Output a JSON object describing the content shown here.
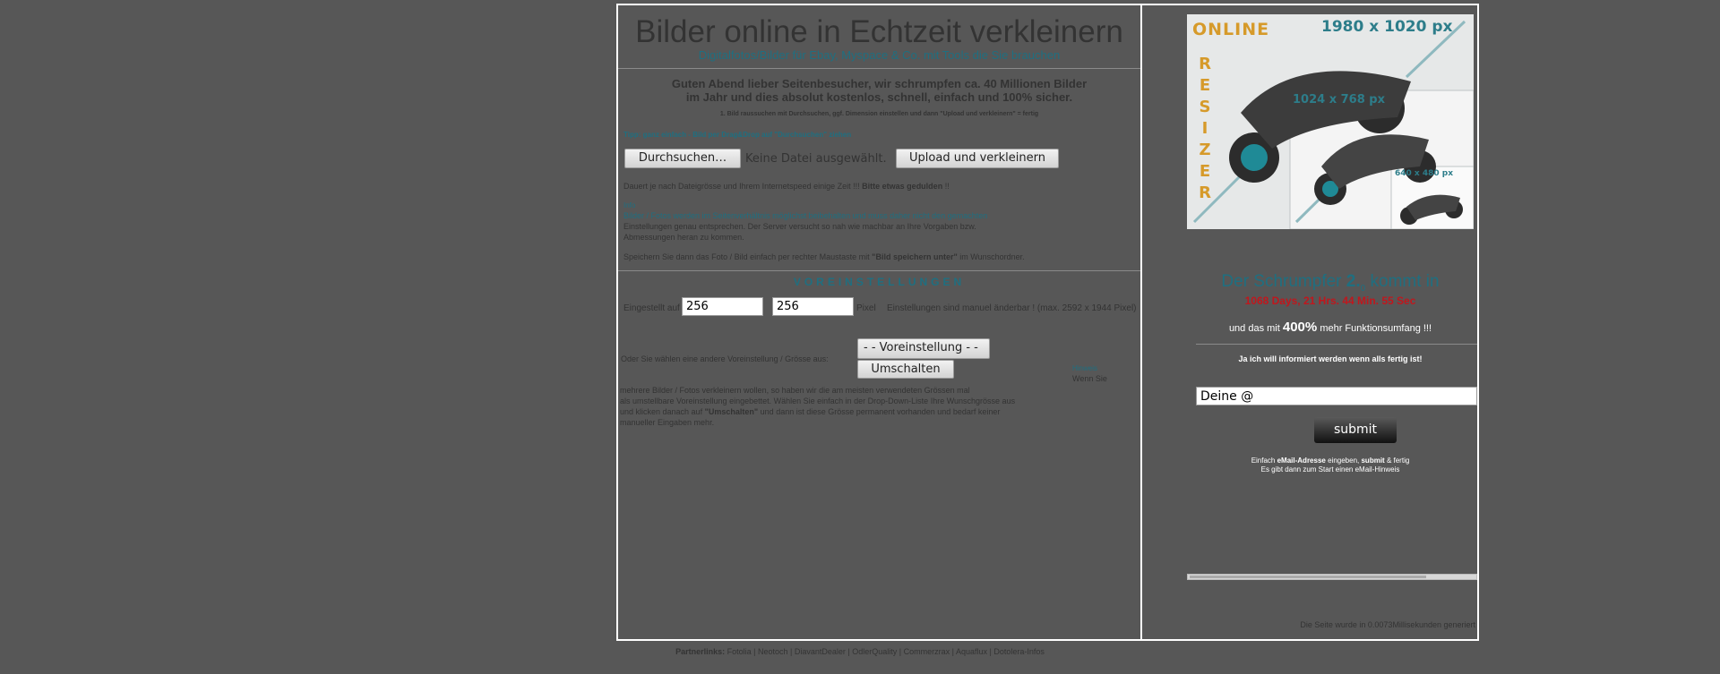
{
  "header": {
    "title": "Bilder online in Echtzeit verkleinern",
    "subtitle": "Digitalfotos/Bilder für Ebay, Myspace & Co. mit Tools die Sie brauchen"
  },
  "intro": {
    "greeting_line1": "Guten Abend lieber Seitenbesucher, wir schrumpfen ca. 40 Millionen Bilder",
    "greeting_line2": "im Jahr und dies absolut kostenlos, schnell, einfach und 100% sicher.",
    "steps": "1. Bild raussuchen mit Durchsuchen, ggf. Dimension einstellen und dann \"Upload und verkleinern\" = fertig",
    "tip": "Tipp: ganz einfach - Bild per Drag&Drop auf \"Durchsuchen\" ziehen"
  },
  "upload": {
    "browse_label": "Durchsuchen…",
    "no_file_text": "Keine Datei ausgewählt.",
    "upload_label": "Upload und verkleinern"
  },
  "info": {
    "wait_text": "Dauert je nach Dateigrösse und Ihrem Internetspeed einige Zeit !!!",
    "wait_bold": "Bitte etwas gedulden",
    "wait_end": "!!",
    "label_small": "Info",
    "ratio_text1": "Bilder / Fotos werden im Seitenverhältnis möglichst beibehalten und muss daher nicht den gemachten",
    "ratio_text2": "Einstellungen genau entsprechen. Der Server versucht so nah wie machbar an Ihre Vorgaben bzw.",
    "ratio_text3": "Abmessungen heran zu kommen.",
    "save_text": "Speichern Sie dann das Foto / Bild einfach per rechter Maustaste mit",
    "save_bold": "\"Bild speichern unter\"",
    "save_end": "im Wunschordner."
  },
  "settings": {
    "section_title": "VOREINSTELLUNGEN",
    "size_label": "Eingestellt auf",
    "width_value": "256",
    "height_value": "256",
    "unit": "Pixel",
    "manual_note": "Einstellungen sind manuel änderbar ! (max. 2592 x 1944 Pixel)",
    "preset_label": "Oder Sie wählen eine andere Voreinstellung / Grösse aus:",
    "preset_selected": "- - Voreinstellung - -",
    "switch_label": "Umschalten",
    "side_link": "Hinweis",
    "side_text": "Wenn Sie",
    "desc1": "mehrere Bilder / Fotos verkleinern wollen, so haben wir die am meisten verwendeten Grössen mal",
    "desc2": "als umstellbare Voreinstellung eingebettet. Wählen Sie einfach in der Drop-Down-Liste Ihre Wunschgrösse aus",
    "desc3": "und klicken danach auf",
    "desc3_bold": "\"Umschalten\"",
    "desc3_end": "und dann ist diese Grösse permanent vorhanden und bedarf keiner",
    "desc4": "manueller Eingaben mehr."
  },
  "promo_image": {
    "online": "ONLINE",
    "resizer": [
      "R",
      "E",
      "S",
      "I",
      "Z",
      "E",
      "R"
    ],
    "size_large": "1980 x 1020 px",
    "size_medium": "1024 x 768 px",
    "size_small": "640 x 480 px"
  },
  "sidebar": {
    "countdown_title_prefix": "Der Schrumpfer",
    "countdown_version": "2.",
    "countdown_version_small": "0",
    "countdown_title_suffix": "kommt in",
    "countdown_value": "1068 Days, 21 Hrs. 44 Min. 55 Sec",
    "feature_prefix": "und das mit",
    "feature_percent": "400%",
    "feature_suffix": "mehr Funktionsumfang !!!",
    "notify_text": "Ja ich will informiert werden wenn alls fertig ist!",
    "email_placeholder": "Deine @",
    "submit_label": "submit",
    "hint_prefix": "Einfach",
    "hint_bold1": "eMail-Adresse",
    "hint_mid": "eingeben,",
    "hint_bold2": "submit",
    "hint_end": "& fertig",
    "hint_line2": "Es gibt dann zum Start einen eMail-Hinweis",
    "generated_text": "Die Seite wurde in 0.0073Millisekunden generiert"
  },
  "footer": {
    "label": "Partnerlinks:",
    "links": [
      "Fotolia",
      "Neotoch",
      "DiavantDealer",
      "OdlerQuality",
      "Commerzrax",
      "Aquaflux",
      "Dotolera-Infos"
    ]
  },
  "colors": {
    "background": "#575757",
    "accent_teal": "#1f6f80",
    "countdown_red": "#c0171d"
  }
}
